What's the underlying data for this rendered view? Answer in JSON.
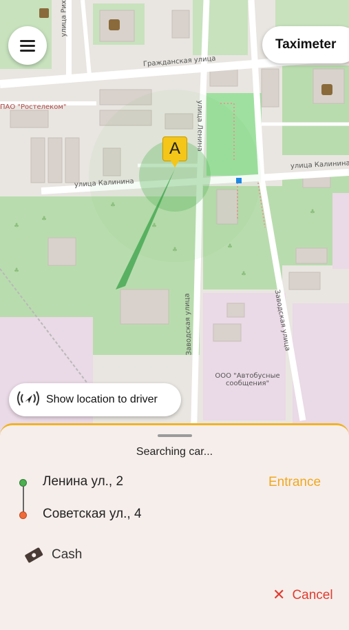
{
  "map": {
    "streets": {
      "grazhdanskaya": "Гражданская улица",
      "kalinina_left": "улица Калинина",
      "kalinina_right": "улица Калинина",
      "lenina": "улица Ленина",
      "zavodskaya_right": "Заводская улица",
      "zavodskaya_mid": "Заводская улица",
      "sorge": "улица Рихарда Зорге"
    },
    "pois": {
      "rostelecom": "ПАО \"Ростелеком\"",
      "bus": "ООО \"Автобусные сообщения\""
    },
    "pin_label": "A"
  },
  "header": {
    "menu_icon": "hamburger-menu-icon",
    "taximeter_label": "Taximeter"
  },
  "location_button": {
    "icon": "location-broadcast-icon",
    "label": "Show location to driver"
  },
  "sheet": {
    "status": "Searching car...",
    "route": {
      "from": "Ленина ул., 2",
      "to": "Советская ул., 4",
      "from_color": "#4caf50",
      "to_color": "#ef6c3a"
    },
    "entrance_label": "Entrance",
    "payment": {
      "icon": "cash-icon",
      "label": "Cash"
    },
    "cancel": {
      "icon": "close-icon",
      "label": "Cancel"
    },
    "accent_color": "#f0b323"
  }
}
